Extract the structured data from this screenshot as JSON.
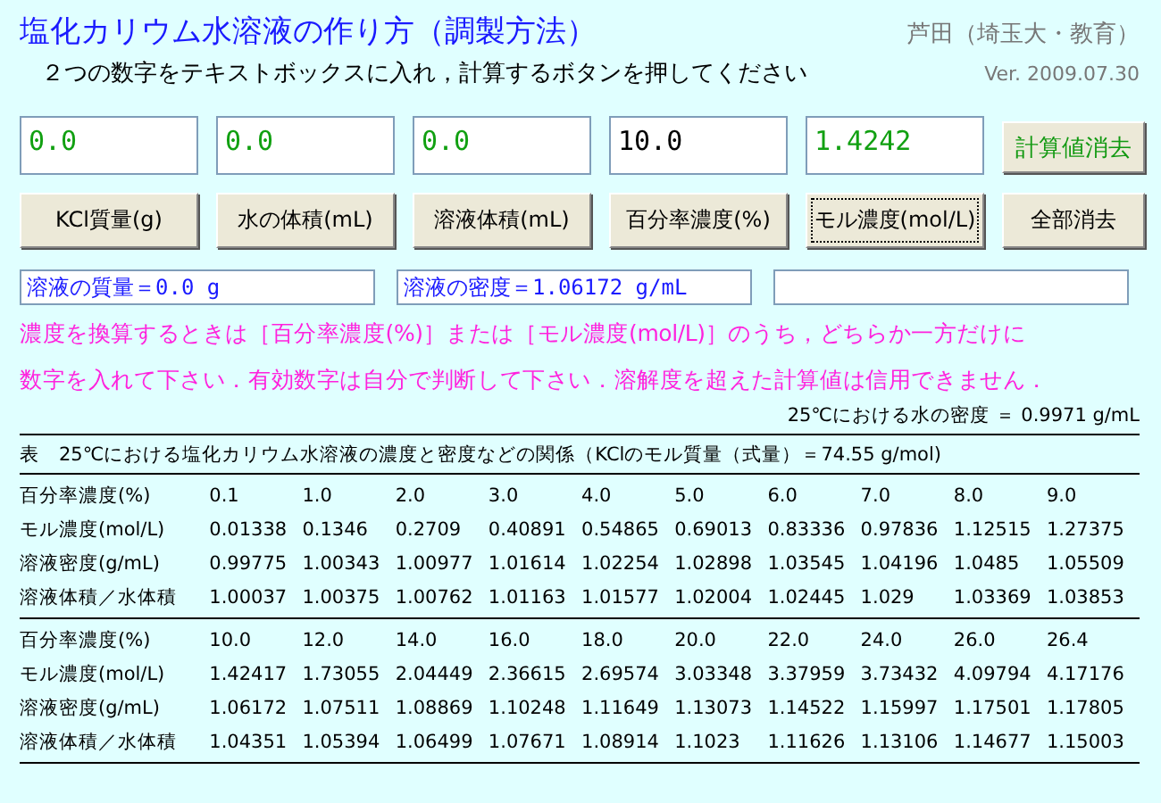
{
  "title": "塩化カリウム水溶液の作り方（調製方法）",
  "author": "芦田（埼玉大・教育）",
  "instruction": "２つの数字をテキストボックスに入れ，計算するボタンを押してください",
  "version": "Ver. 2009.07.30",
  "fields": [
    {
      "value": "0.0",
      "computed": true
    },
    {
      "value": "0.0",
      "computed": true
    },
    {
      "value": "0.0",
      "computed": true
    },
    {
      "value": "10.0",
      "computed": false
    },
    {
      "value": "1.4242",
      "computed": true
    }
  ],
  "clear_results_button": "計算値消去",
  "buttons": [
    {
      "label": "KCl質量(g)",
      "focused": false
    },
    {
      "label": "水の体積(mL)",
      "focused": false
    },
    {
      "label": "溶液体積(mL)",
      "focused": false
    },
    {
      "label": "百分率濃度(%)",
      "focused": false
    },
    {
      "label": "モル濃度(mol/L)",
      "focused": true
    }
  ],
  "clear_all_button": "全部消去",
  "results": [
    "溶液の質量＝0.0 g",
    "溶液の密度＝1.06172 g/mL"
  ],
  "notes": [
    "濃度を換算するときは［百分率濃度(%)］または［モル濃度(mol/L)］のうち，どちらか一方だけに",
    "数字を入れて下さい．有効数字は自分で判断して下さい．溶解度を超えた計算値は信用できません．"
  ],
  "water_density": "25℃における水の密度 ＝ 0.9971 g/mL",
  "table": {
    "caption": "表　25℃における塩化カリウム水溶液の濃度と密度などの関係（KClのモル質量（式量）＝74.55 g/mol)",
    "blocks": [
      [
        [
          "百分率濃度(%)",
          "0.1",
          "1.0",
          "2.0",
          "3.0",
          "4.0",
          "5.0",
          "6.0",
          "7.0",
          "8.0",
          "9.0"
        ],
        [
          "モル濃度(mol/L)",
          "0.01338",
          "0.1346",
          "0.2709",
          "0.40891",
          "0.54865",
          "0.69013",
          "0.83336",
          "0.97836",
          "1.12515",
          "1.27375"
        ],
        [
          "溶液密度(g/mL)",
          "0.99775",
          "1.00343",
          "1.00977",
          "1.01614",
          "1.02254",
          "1.02898",
          "1.03545",
          "1.04196",
          "1.0485",
          "1.05509"
        ],
        [
          "溶液体積／水体積",
          "1.00037",
          "1.00375",
          "1.00762",
          "1.01163",
          "1.01577",
          "1.02004",
          "1.02445",
          "1.029",
          "1.03369",
          "1.03853"
        ]
      ],
      [
        [
          "百分率濃度(%)",
          "10.0",
          "12.0",
          "14.0",
          "16.0",
          "18.0",
          "20.0",
          "22.0",
          "24.0",
          "26.0",
          "26.4"
        ],
        [
          "モル濃度(mol/L)",
          "1.42417",
          "1.73055",
          "2.04449",
          "2.36615",
          "2.69574",
          "3.03348",
          "3.37959",
          "3.73432",
          "4.09794",
          "4.17176"
        ],
        [
          "溶液密度(g/mL)",
          "1.06172",
          "1.07511",
          "1.08869",
          "1.10248",
          "1.11649",
          "1.13073",
          "1.14522",
          "1.15997",
          "1.17501",
          "1.17805"
        ],
        [
          "溶液体積／水体積",
          "1.04351",
          "1.05394",
          "1.06499",
          "1.07671",
          "1.08914",
          "1.1023",
          "1.11626",
          "1.13106",
          "1.14677",
          "1.15003"
        ]
      ]
    ]
  }
}
